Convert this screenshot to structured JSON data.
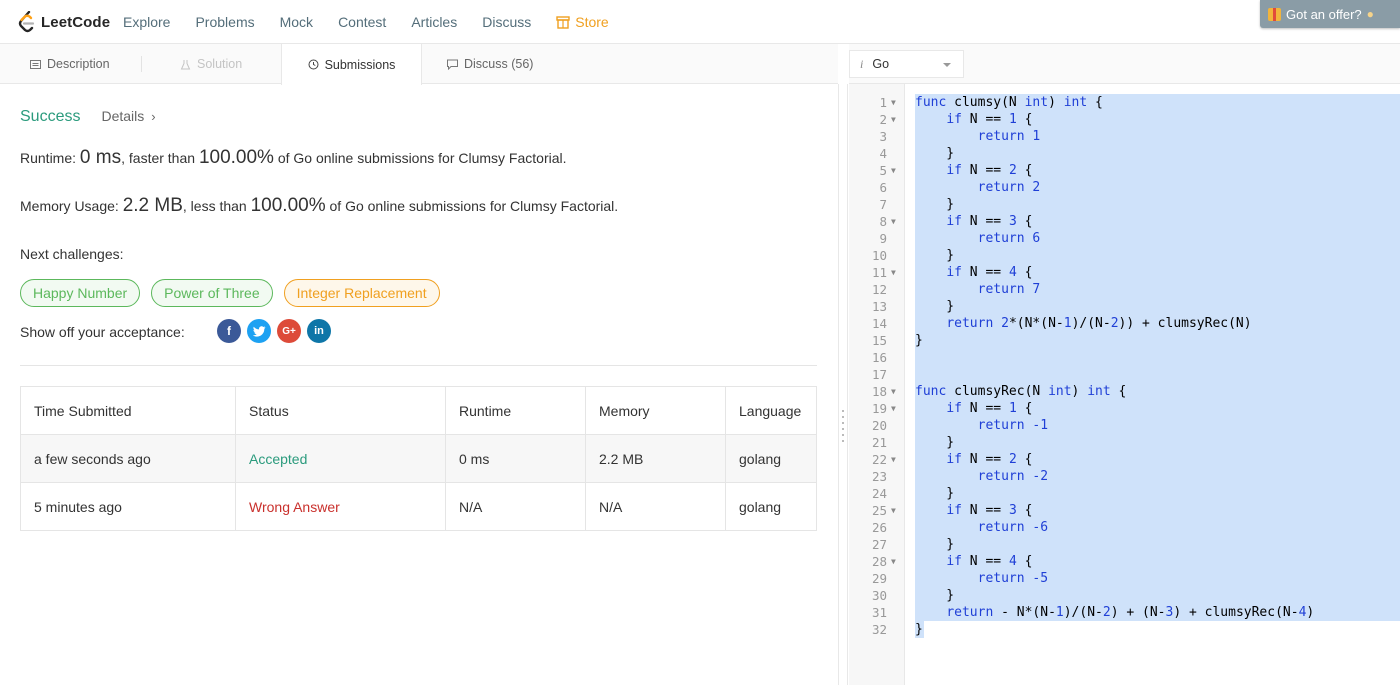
{
  "nav": {
    "logo": "LeetCode",
    "links": [
      "Explore",
      "Problems",
      "Mock",
      "Contest",
      "Articles",
      "Discuss"
    ],
    "store": "Store",
    "offer": "Got an offer?"
  },
  "tabs": {
    "description": "Description",
    "solution": "Solution",
    "submissions": "Submissions",
    "discuss": "Discuss (56)"
  },
  "result": {
    "status": "Success",
    "details": "Details",
    "runtime_label": "Runtime: ",
    "runtime_value": "0 ms",
    "runtime_mid": ", faster than ",
    "runtime_pct": "100.00%",
    "runtime_tail": " of Go online submissions for Clumsy Factorial.",
    "memory_label": "Memory Usage: ",
    "memory_value": "2.2 MB",
    "memory_mid": ", less than ",
    "memory_pct": "100.00%",
    "memory_tail": " of Go online submissions for Clumsy Factorial.",
    "next_label": "Next challenges:",
    "challenges": [
      "Happy Number",
      "Power of Three",
      "Integer Replacement"
    ],
    "share_label": "Show off your acceptance:"
  },
  "table": {
    "headers": [
      "Time Submitted",
      "Status",
      "Runtime",
      "Memory",
      "Language"
    ],
    "rows": [
      [
        "a few seconds ago",
        "Accepted",
        "0 ms",
        "2.2 MB",
        "golang"
      ],
      [
        "5 minutes ago",
        "Wrong Answer",
        "N/A",
        "N/A",
        "golang"
      ]
    ]
  },
  "editor": {
    "language": "Go",
    "lines": [
      "func clumsy(N int) int {",
      "    if N == 1 {",
      "        return 1",
      "    }",
      "    if N == 2 {",
      "        return 2",
      "    }",
      "    if N == 3 {",
      "        return 6",
      "    }",
      "    if N == 4 {",
      "        return 7",
      "    }",
      "    return 2*(N*(N-1)/(N-2)) + clumsyRec(N)",
      "}",
      "",
      "",
      "func clumsyRec(N int) int {",
      "    if N == 1 {",
      "        return -1",
      "    }",
      "    if N == 2 {",
      "        return -2",
      "    }",
      "    if N == 3 {",
      "        return -6",
      "    }",
      "    if N == 4 {",
      "        return -5",
      "    }",
      "    return - N*(N-1)/(N-2) + (N-3) + clumsyRec(N-4)",
      "}"
    ],
    "fold_lines": [
      1,
      2,
      5,
      8,
      11,
      18,
      19,
      22,
      25,
      28
    ]
  },
  "colors": {
    "success": "#2b9b7d",
    "wrong": "#c9302c",
    "store": "#f0a020",
    "selection": "#cfe2fa",
    "keyword": "#1f3fd6"
  }
}
